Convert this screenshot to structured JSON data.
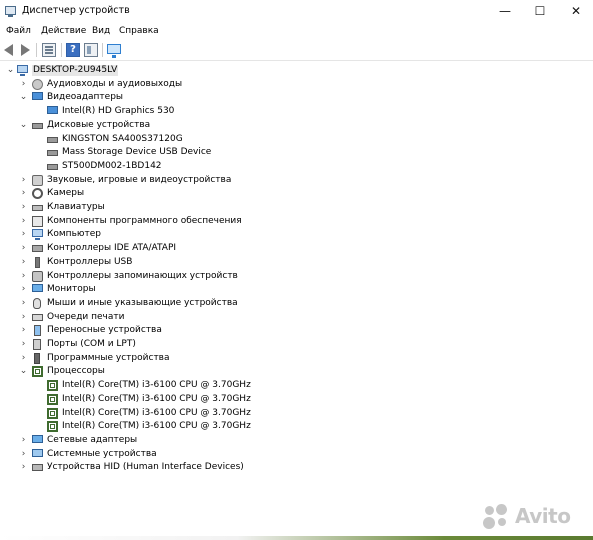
{
  "window": {
    "title": "Диспетчер устройств",
    "buttons": {
      "minimize": "—",
      "maximize": "☐",
      "close": "✕"
    }
  },
  "menu": {
    "items": [
      "Файл",
      "Действие",
      "Вид",
      "Справка"
    ]
  },
  "toolbar": {
    "icons": [
      "back-icon",
      "forward-icon",
      "properties-icon",
      "help-icon",
      "update-driver-icon",
      "scan-hardware-icon"
    ],
    "help_glyph": "?"
  },
  "tree": {
    "root": {
      "label": "DESKTOP-2U945LV",
      "expander": "⌄"
    },
    "categories": [
      {
        "label": "Аудиовходы и аудиовыходы",
        "icon": "audio",
        "expanded": false,
        "children": []
      },
      {
        "label": "Видеоадаптеры",
        "icon": "display",
        "expanded": true,
        "children": [
          {
            "label": "Intel(R) HD Graphics 530",
            "icon": "display"
          }
        ]
      },
      {
        "label": "Дисковые устройства",
        "icon": "disk",
        "expanded": true,
        "children": [
          {
            "label": "KINGSTON SA400S37120G",
            "icon": "disk"
          },
          {
            "label": "Mass Storage Device USB Device",
            "icon": "disk"
          },
          {
            "label": "ST500DM002-1BD142",
            "icon": "disk"
          }
        ]
      },
      {
        "label": "Звуковые, игровые и видеоустройства",
        "icon": "sound",
        "expanded": false,
        "children": []
      },
      {
        "label": "Камеры",
        "icon": "camera",
        "expanded": false,
        "children": []
      },
      {
        "label": "Клавиатуры",
        "icon": "keyboard",
        "expanded": false,
        "children": []
      },
      {
        "label": "Компоненты программного обеспечения",
        "icon": "software",
        "expanded": false,
        "children": []
      },
      {
        "label": "Компьютер",
        "icon": "computer",
        "expanded": false,
        "children": []
      },
      {
        "label": "Контроллеры IDE ATA/ATAPI",
        "icon": "ide",
        "expanded": false,
        "children": []
      },
      {
        "label": "Контроллеры USB",
        "icon": "usb",
        "expanded": false,
        "children": []
      },
      {
        "label": "Контроллеры запоминающих устройств",
        "icon": "storage",
        "expanded": false,
        "children": []
      },
      {
        "label": "Мониторы",
        "icon": "monitor",
        "expanded": false,
        "children": []
      },
      {
        "label": "Мыши и иные указывающие устройства",
        "icon": "mouse",
        "expanded": false,
        "children": []
      },
      {
        "label": "Очереди печати",
        "icon": "printer",
        "expanded": false,
        "children": []
      },
      {
        "label": "Переносные устройства",
        "icon": "portable",
        "expanded": false,
        "children": []
      },
      {
        "label": "Порты (COM и LPT)",
        "icon": "port",
        "expanded": false,
        "children": []
      },
      {
        "label": "Программные устройства",
        "icon": "firmware",
        "expanded": false,
        "children": []
      },
      {
        "label": "Процессоры",
        "icon": "cpu",
        "expanded": true,
        "children": [
          {
            "label": "Intel(R) Core(TM) i3-6100 CPU @ 3.70GHz",
            "icon": "cpu"
          },
          {
            "label": "Intel(R) Core(TM) i3-6100 CPU @ 3.70GHz",
            "icon": "cpu"
          },
          {
            "label": "Intel(R) Core(TM) i3-6100 CPU @ 3.70GHz",
            "icon": "cpu"
          },
          {
            "label": "Intel(R) Core(TM) i3-6100 CPU @ 3.70GHz",
            "icon": "cpu"
          }
        ]
      },
      {
        "label": "Сетевые адаптеры",
        "icon": "network",
        "expanded": false,
        "children": []
      },
      {
        "label": "Системные устройства",
        "icon": "system",
        "expanded": false,
        "children": []
      },
      {
        "label": "Устройства HID (Human Interface Devices)",
        "icon": "hid",
        "expanded": false,
        "children": []
      }
    ]
  },
  "watermark": {
    "text": "Avito"
  },
  "expanders": {
    "collapsed": "›",
    "expanded": "⌄"
  }
}
